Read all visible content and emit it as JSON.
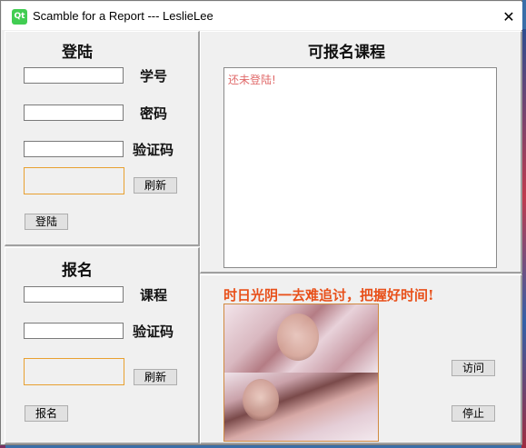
{
  "window": {
    "title": "Scamble for a Report --- LeslieLee",
    "app_icon": "qt-logo",
    "app_icon_text": "Qt",
    "close_glyph": "✕"
  },
  "login": {
    "heading": "登陆",
    "student_id_label": "学号",
    "student_id_value": "",
    "password_label": "密码",
    "password_value": "",
    "captcha_label": "验证码",
    "captcha_value": "",
    "refresh_label": "刷新",
    "login_button": "登陆"
  },
  "courses": {
    "heading": "可报名课程",
    "status_text": "还未登陆!"
  },
  "enroll": {
    "heading": "报名",
    "course_label": "课程",
    "course_value": "",
    "captcha_label": "验证码",
    "captcha_value": "",
    "refresh_label": "刷新",
    "enroll_button": "报名"
  },
  "media": {
    "slogan": "时日光阴一去难追讨，把握好时间!",
    "visit_button": "访问",
    "stop_button": "停止"
  },
  "colors": {
    "slogan": "#e8501a",
    "status_text": "#e06a6a",
    "captcha_border": "#e8a030"
  }
}
